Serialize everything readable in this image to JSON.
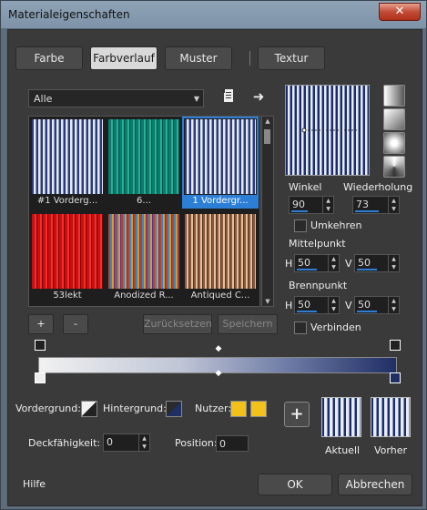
{
  "window": {
    "title": "Materialeigenschaften",
    "close": "✕"
  },
  "tabs": [
    {
      "label": "Farbe"
    },
    {
      "label": "Farbverlauf"
    },
    {
      "label": "Muster"
    },
    {
      "label": "Textur"
    }
  ],
  "filter": {
    "value": "Alle"
  },
  "gallery": {
    "items": [
      {
        "caption": "#1 Vorderg..."
      },
      {
        "caption": "6..."
      },
      {
        "caption": "1 Vordergr..."
      },
      {
        "caption": "53lekt"
      },
      {
        "caption": "Anodized R..."
      },
      {
        "caption": "Antiqued C..."
      }
    ]
  },
  "buttons": {
    "add": "+",
    "remove": "-",
    "reset": "Zurücksetzen",
    "save": "Speichern"
  },
  "angle": {
    "label": "Winkel",
    "value": "90"
  },
  "repeat": {
    "label": "Wiederholung",
    "value": "73"
  },
  "invert": {
    "label": "Umkehren"
  },
  "center": {
    "label": "Mittelpunkt",
    "h_label": "H",
    "h_value": "50",
    "v_label": "V",
    "v_value": "50"
  },
  "focal": {
    "label": "Brennpunkt",
    "h_label": "H",
    "h_value": "50",
    "v_label": "V",
    "v_value": "50"
  },
  "link": {
    "label": "Verbinden"
  },
  "bottom": {
    "foreground": "Vordergrund:",
    "background": "Hintergrund:",
    "user": "Nutzer:",
    "opacity_label": "Deckfähigkeit:",
    "opacity_value": "0",
    "position_label": "Position:",
    "position_value": "0",
    "current": "Aktuell",
    "previous": "Vorher",
    "plus": "+"
  },
  "footer": {
    "help": "Hilfe",
    "ok": "OK",
    "cancel": "Abbrechen"
  },
  "colors": {
    "accent": "#2d7fd6",
    "user1": "#f2c21b",
    "user2": "#f2c21b",
    "navy": "#1f2e64"
  },
  "icons": [
    "page-icon",
    "arrow-right-icon",
    "linear-gradient-icon",
    "rectangular-gradient-icon",
    "sunburst-gradient-icon",
    "radial-gradient-icon"
  ]
}
